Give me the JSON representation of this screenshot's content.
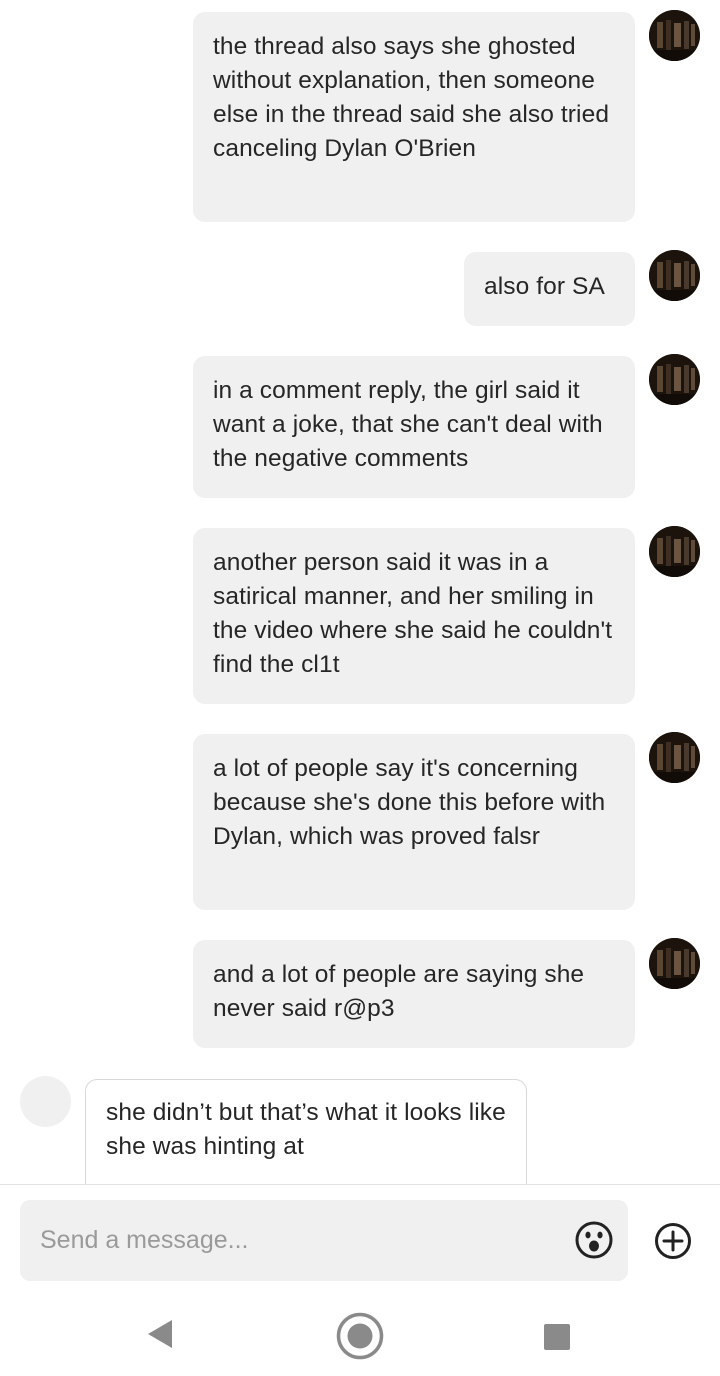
{
  "conversation": {
    "messages": [
      {
        "direction": "sent",
        "text": "the thread also says she ghosted without explanation, then someone else in the thread said she also tried canceling Dylan O'Brien"
      },
      {
        "direction": "sent",
        "text": "also for SA"
      },
      {
        "direction": "sent",
        "text": "in a comment reply, the girl said it want a joke, that she can't deal with the negative comments"
      },
      {
        "direction": "sent",
        "text": "another person said it was in a satirical manner, and her smiling in the video where she said he couldn't find the cl1t"
      },
      {
        "direction": "sent",
        "text": "a lot of people say it's concerning because she's done this before with Dylan, which was proved falsr"
      },
      {
        "direction": "sent",
        "text": "and a lot of people are saying she never said r@p3"
      },
      {
        "direction": "received",
        "text": "she didn’t but that’s what it looks like she was hinting at"
      }
    ]
  },
  "composer": {
    "placeholder": "Send a message...",
    "value": "",
    "emoji_icon": "emoji-face-icon",
    "add_icon": "plus-circle-icon"
  },
  "navigation": {
    "back_icon": "back-triangle-icon",
    "home_icon": "home-circle-icon",
    "recents_icon": "recents-square-icon"
  },
  "colors": {
    "sent_bubble": "#f0f0f0",
    "received_bubble_border": "#d8d8d8",
    "placeholder": "#9a9a9a",
    "icon": "#222222",
    "nav_icon": "#8a8a8a"
  }
}
